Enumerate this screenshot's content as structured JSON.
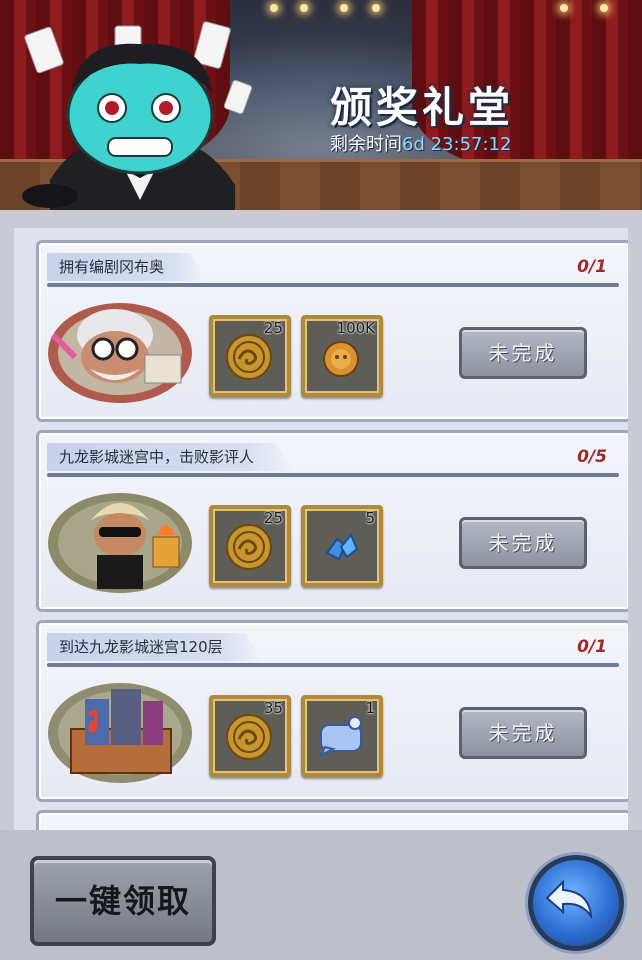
{
  "header": {
    "title": "颁奖礼堂",
    "timer_label": "剩余时间",
    "timer_value": "6d 23:57:12"
  },
  "tasks": [
    {
      "name": "拥有编剧冈布奥",
      "progress": "0/1",
      "rewards": [
        {
          "icon": "dragon-coin-icon",
          "count": "25"
        },
        {
          "icon": "gold-coin-icon",
          "count": "100K"
        }
      ],
      "status": "未完成"
    },
    {
      "name": "九龙影城迷宫中，击败影评人",
      "progress": "0/5",
      "rewards": [
        {
          "icon": "dragon-coin-icon",
          "count": "25"
        },
        {
          "icon": "blue-crystal-icon",
          "count": "5"
        }
      ],
      "status": "未完成"
    },
    {
      "name": "到达九龙影城迷宫120层",
      "progress": "0/1",
      "rewards": [
        {
          "icon": "dragon-coin-icon",
          "count": "35"
        },
        {
          "icon": "speech-bubble-frame-icon",
          "count": "1"
        }
      ],
      "status": "未完成"
    }
  ],
  "footer": {
    "claim_all_label": "一键领取",
    "back_icon": "back-arrow-icon"
  },
  "colors": {
    "progress": "#9b2a25",
    "reward_border": "#b08a3a",
    "timer_value": "#8fd7ff"
  }
}
